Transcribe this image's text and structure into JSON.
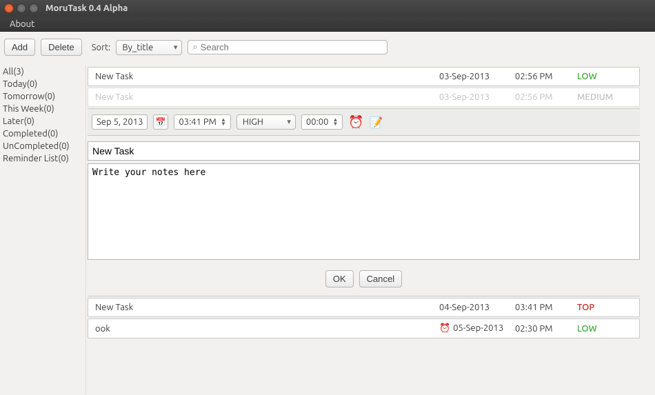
{
  "window": {
    "title": "MoruTask 0.4 Alpha"
  },
  "menu": {
    "about": "About"
  },
  "toolbar": {
    "add": "Add",
    "delete": "Delete",
    "sort_label": "Sort:",
    "sort_value": "By_title",
    "search_placeholder": "Search"
  },
  "sidebar": {
    "items": [
      {
        "label": "All(3)"
      },
      {
        "label": "Today(0)"
      },
      {
        "label": "Tomorrow(0)"
      },
      {
        "label": "This Week(0)"
      },
      {
        "label": "Later(0)"
      },
      {
        "label": "Completed(0)"
      },
      {
        "label": "UnCompleted(0)"
      },
      {
        "label": "Reminder List(0)"
      }
    ]
  },
  "tasks": {
    "r0": {
      "title": "New Task",
      "date": "03-Sep-2013",
      "time": "02:56 PM",
      "priority": "LOW"
    },
    "r1": {
      "title": "New Task",
      "date": "03-Sep-2013",
      "time": "02:56 PM",
      "priority": "MEDIUM"
    },
    "r2": {
      "title": "New Task",
      "date": "04-Sep-2013",
      "time": "03:41 PM",
      "priority": "TOP"
    },
    "r3": {
      "title": "ook",
      "date": "05-Sep-2013",
      "time": "02:30 PM",
      "priority": "LOW",
      "has_alarm": true
    }
  },
  "editor": {
    "date": "Sep 5, 2013",
    "time": "03:41 PM",
    "priority": "HIGH",
    "duration": "00:00",
    "title": "New Task",
    "notes": "Write your notes here",
    "ok": "OK",
    "cancel": "Cancel"
  },
  "colors": {
    "low": "#3aaa35",
    "top": "#c02828",
    "accent_blue": "#2a7ad1"
  }
}
